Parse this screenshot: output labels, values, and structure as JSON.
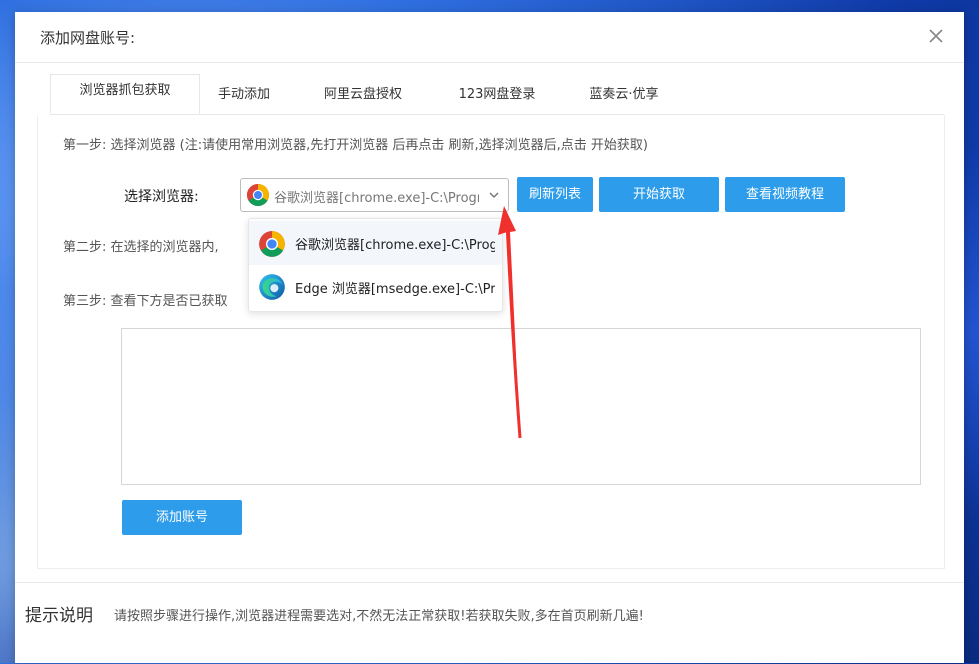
{
  "dialog": {
    "title": "添加网盘账号:",
    "tabs": [
      {
        "label": "浏览器抓包获取"
      },
      {
        "label": "手动添加"
      },
      {
        "label": "阿里云盘授权"
      },
      {
        "label": "123网盘登录"
      },
      {
        "label": "蓝奏云·优享"
      }
    ],
    "steps": {
      "step1": "第一步: 选择浏览器 (注:请使用常用浏览器,先打开浏览器 后再点击 刷新,选择浏览器后,点击 开始获取)",
      "step2": "第二步: 在选择的浏览器内,",
      "step3": "第三步: 查看下方是否已获取"
    },
    "browser_select": {
      "label": "选择浏览器:",
      "value": "谷歌浏览器[chrome.exe]-C:\\Program Files\\Google"
    },
    "buttons": {
      "refresh": "刷新列表",
      "start": "开始获取",
      "tutorial": "查看视频教程",
      "add_account": "添加账号"
    },
    "dropdown_options": [
      {
        "label": "谷歌浏览器[chrome.exe]-C:\\Program Files",
        "icon": "chrome-icon"
      },
      {
        "label": "Edge 浏览器[msedge.exe]-C:\\Program Files",
        "icon": "edge-icon"
      }
    ],
    "result_text": ""
  },
  "footer": {
    "heading": "提示说明",
    "text": "请按照步骤进行操作,浏览器进程需要选对,不然无法正常获取!若获取失败,多在首页刷新几遍!"
  },
  "colors": {
    "primary_button": "#2d9cea",
    "annotation_arrow": "#f0302c"
  }
}
